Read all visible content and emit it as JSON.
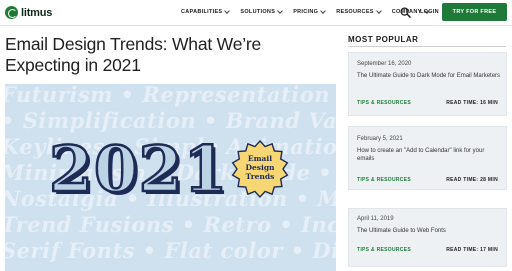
{
  "brand": {
    "name": "litmus",
    "accent": "#1f7a3a"
  },
  "nav": {
    "items": [
      {
        "label": "CAPABILITIES"
      },
      {
        "label": "SOLUTIONS"
      },
      {
        "label": "PRICING"
      },
      {
        "label": "RESOURCES"
      },
      {
        "label": "COMPANY"
      }
    ],
    "login": "LOGIN",
    "cta": "TRY FOR FREE",
    "search_icon": "search-icon"
  },
  "article": {
    "title": "Email Design Trends: What We’re Expecting in 2021",
    "hero": {
      "year": "2021",
      "badge_lines": [
        "Email",
        "Design",
        "Trends"
      ],
      "background_lines": [
        "Futurism • Representation •",
        "• Simplification • Brand Values •",
        "Keylines • Simple Animation •",
        "Minimalism • Dark Mode • Retro",
        "Nostalgia • Illustration • Media •",
        "Trend Fusions • Retro • Inclusion •",
        "Serif Fonts • Flat color • Diversity •"
      ]
    }
  },
  "sidebar": {
    "heading": "MOST POPULAR",
    "cards": [
      {
        "date": "September 16, 2020",
        "title": "The Ultimate Guide to Dark Mode for Email Marketers",
        "tag": "TIPS & RESOURCES",
        "read_time": "READ TIME: 16 MIN"
      },
      {
        "date": "February 5, 2021",
        "title": "How to create an \"Add to Calendar\" link for your emails",
        "tag": "TIPS & RESOURCES",
        "read_time": "READ TIME: 28 MIN"
      },
      {
        "date": "April 11, 2019",
        "title": "The Ultimate Guide to Web Fonts",
        "tag": "TIPS & RESOURCES",
        "read_time": "READ TIME: 17 MIN"
      }
    ]
  }
}
